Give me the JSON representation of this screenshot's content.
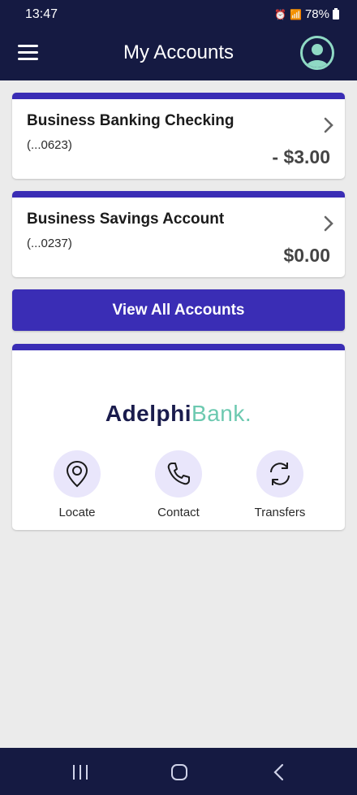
{
  "status_bar": {
    "time": "13:47",
    "battery": "78%"
  },
  "header": {
    "title": "My Accounts"
  },
  "accounts": [
    {
      "name": "Business Banking Checking",
      "number": "(...0623)",
      "balance": "- $3.00"
    },
    {
      "name": "Business Savings Account",
      "number": "(...0237)",
      "balance": "$0.00"
    }
  ],
  "view_all_label": "View All Accounts",
  "brand": {
    "part1": "Adelphi",
    "part2": "Bank",
    "dot": "."
  },
  "quick_actions": [
    {
      "label": "Locate",
      "icon": "location-pin-icon"
    },
    {
      "label": "Contact",
      "icon": "phone-icon"
    },
    {
      "label": "Transfers",
      "icon": "refresh-icon"
    }
  ],
  "colors": {
    "primary": "#3a2db5",
    "header_bg": "#151a42",
    "accent": "#6cc9b0",
    "icon_bg": "#e9e6fb"
  }
}
